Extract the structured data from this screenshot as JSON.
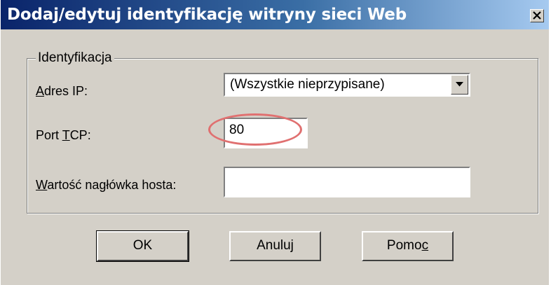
{
  "window": {
    "title": "Dodaj/edytuj identyfikację witryny sieci Web",
    "close_label": "×"
  },
  "identification": {
    "legend": "Identyfikacja",
    "ip_label_prefix": "",
    "ip_label_mnemonic": "A",
    "ip_label_rest": "dres IP:",
    "ip_value": "(Wszystkie nieprzypisane)",
    "port_label_prefix": "Port ",
    "port_label_mnemonic": "T",
    "port_label_rest": "CP:",
    "port_value": "80",
    "host_label_prefix": "",
    "host_label_mnemonic": "W",
    "host_label_rest": "artość nagłówka hosta:",
    "host_value": ""
  },
  "buttons": {
    "ok": "OK",
    "cancel": "Anuluj",
    "help_prefix": "Pomo",
    "help_mnemonic": "c"
  },
  "colors": {
    "titlebar_start": "#0a246a",
    "titlebar_end": "#a6caf0",
    "dialog_bg": "#d4d0c8",
    "highlight": "#e07070"
  },
  "icons": {
    "close": "close-icon",
    "dropdown": "chevron-down-icon"
  }
}
